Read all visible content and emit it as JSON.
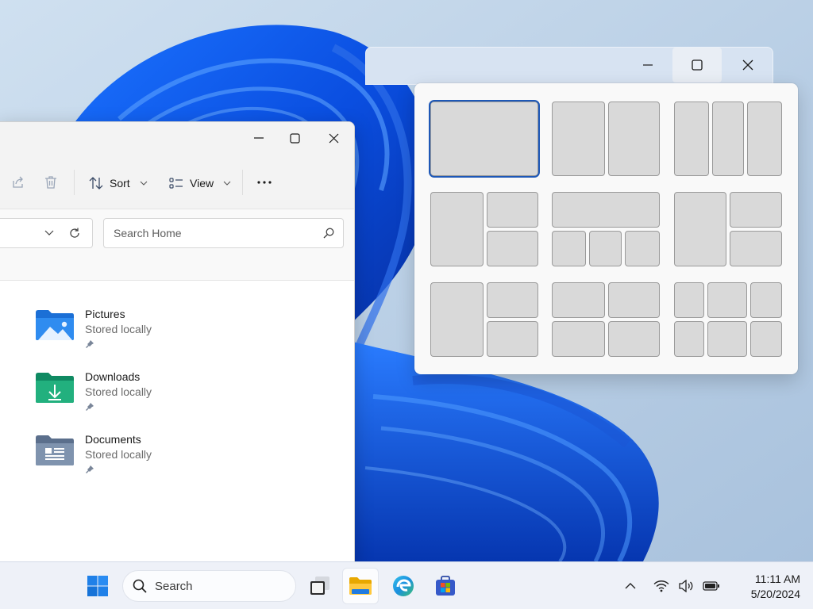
{
  "explorer": {
    "toolbar": {
      "sort_label": "Sort",
      "view_label": "View",
      "share_icon": "share-icon",
      "delete_icon": "trash-icon",
      "more_icon": "ellipsis-icon"
    },
    "search": {
      "placeholder": "Search Home"
    },
    "items": [
      {
        "name": "Pictures",
        "status": "Stored locally",
        "icon": "pictures-folder-icon"
      },
      {
        "name": "Downloads",
        "status": "Stored locally",
        "icon": "downloads-folder-icon"
      },
      {
        "name": "Documents",
        "status": "Stored locally",
        "icon": "documents-folder-icon"
      }
    ]
  },
  "back_window": {
    "controls": [
      "minimize-icon",
      "maximize-icon",
      "close-icon"
    ],
    "hovered_control": "maximize"
  },
  "snap_layouts": {
    "selected_index": 0,
    "count": 9
  },
  "taskbar": {
    "search_label": "Search",
    "apps": [
      "start-icon",
      "task-view-icon",
      "file-explorer-icon",
      "edge-icon",
      "store-icon"
    ],
    "active_app": "file-explorer",
    "tray": [
      "chevron-up-icon",
      "wifi-icon",
      "speaker-icon",
      "battery-icon"
    ],
    "time": "11:11 AM",
    "date": "5/20/2024"
  },
  "colors": {
    "accent": "#1e58b7",
    "taskbar": "#eef1f8",
    "wallpaper_blue": "#0a5cf0"
  }
}
